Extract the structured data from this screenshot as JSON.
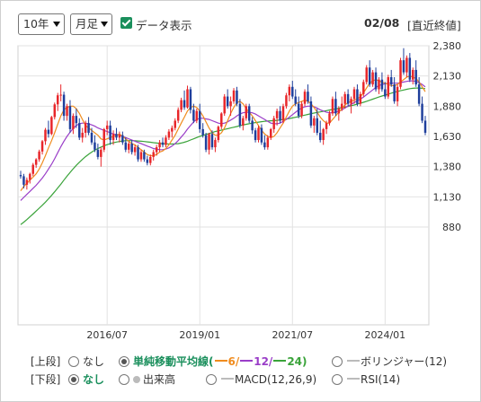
{
  "toolbar": {
    "period_select": "10年",
    "interval_select": "月足",
    "show_data_label": "データ表示",
    "date": "02/08",
    "price_type": "[直近終値]"
  },
  "panels": {
    "upper_label": "[上段]",
    "lower_label": "[下段]",
    "upper_options": {
      "none": "なし",
      "sma_prefix": "単純移動平均線(",
      "sma_6": "6/",
      "sma_12": "12/",
      "sma_24": "24)",
      "bollinger": "ボリンジャー(12)"
    },
    "lower_options": {
      "none": "なし",
      "volume": "出来高",
      "macd": "MACD(12,26,9)",
      "rsi": "RSI(14)"
    },
    "selected_upper": "sma",
    "selected_lower": "none"
  },
  "colors": {
    "up_candle": "#e8262a",
    "down_candle": "#1f3f9c",
    "ma6": "#f08c1e",
    "ma12": "#9a3ec8",
    "ma24": "#3aa33a",
    "accent_green": "#1a8f5c",
    "grid": "#e2e2e2"
  },
  "chart_data": {
    "type": "candlestick",
    "interval": "monthly",
    "period": "10年",
    "x_tick_labels": [
      "2016/07",
      "2019/01",
      "2021/07",
      "2024/01"
    ],
    "x_ticks": [
      "2016-07",
      "2019-01",
      "2021-07",
      "2024-01"
    ],
    "y_tick_labels": [
      "2,380",
      "2,130",
      "1,880",
      "1,630",
      "1,380",
      "1,130",
      "880"
    ],
    "ylim": [
      880,
      2380
    ],
    "grid": true,
    "start_month": "2014-03",
    "series_names": [
      "6",
      "12",
      "24"
    ],
    "candles_ohlc": [
      [
        1310,
        1345,
        1280,
        1300
      ],
      [
        1300,
        1320,
        1200,
        1230
      ],
      [
        1230,
        1290,
        1190,
        1270
      ],
      [
        1270,
        1330,
        1240,
        1320
      ],
      [
        1320,
        1410,
        1300,
        1395
      ],
      [
        1395,
        1450,
        1370,
        1440
      ],
      [
        1440,
        1520,
        1420,
        1505
      ],
      [
        1505,
        1600,
        1480,
        1590
      ],
      [
        1590,
        1700,
        1560,
        1685
      ],
      [
        1685,
        1760,
        1620,
        1650
      ],
      [
        1650,
        1800,
        1640,
        1790
      ],
      [
        1790,
        1910,
        1770,
        1895
      ],
      [
        1895,
        1990,
        1840,
        1970
      ],
      [
        1970,
        2060,
        1920,
        1975
      ],
      [
        1975,
        2000,
        1760,
        1800
      ],
      [
        1800,
        1900,
        1760,
        1880
      ],
      [
        1880,
        1930,
        1660,
        1690
      ],
      [
        1690,
        1820,
        1650,
        1800
      ],
      [
        1800,
        1860,
        1700,
        1740
      ],
      [
        1740,
        1780,
        1600,
        1620
      ],
      [
        1620,
        1700,
        1580,
        1660
      ],
      [
        1660,
        1760,
        1620,
        1740
      ],
      [
        1740,
        1790,
        1640,
        1660
      ],
      [
        1660,
        1700,
        1560,
        1580
      ],
      [
        1580,
        1640,
        1500,
        1520
      ],
      [
        1520,
        1570,
        1440,
        1460
      ],
      [
        1460,
        1540,
        1380,
        1520
      ],
      [
        1520,
        1700,
        1500,
        1690
      ],
      [
        1690,
        1760,
        1640,
        1720
      ],
      [
        1720,
        1760,
        1560,
        1600
      ],
      [
        1600,
        1680,
        1560,
        1650
      ],
      [
        1650,
        1700,
        1600,
        1620
      ],
      [
        1620,
        1670,
        1580,
        1640
      ],
      [
        1640,
        1670,
        1560,
        1580
      ],
      [
        1580,
        1620,
        1500,
        1520
      ],
      [
        1520,
        1590,
        1490,
        1570
      ],
      [
        1570,
        1600,
        1480,
        1500
      ],
      [
        1500,
        1560,
        1470,
        1540
      ],
      [
        1540,
        1560,
        1420,
        1440
      ],
      [
        1440,
        1520,
        1420,
        1500
      ],
      [
        1500,
        1520,
        1420,
        1440
      ],
      [
        1440,
        1470,
        1390,
        1410
      ],
      [
        1410,
        1480,
        1390,
        1460
      ],
      [
        1460,
        1520,
        1430,
        1500
      ],
      [
        1500,
        1560,
        1470,
        1540
      ],
      [
        1540,
        1600,
        1500,
        1580
      ],
      [
        1580,
        1620,
        1540,
        1560
      ],
      [
        1560,
        1640,
        1540,
        1620
      ],
      [
        1620,
        1690,
        1600,
        1670
      ],
      [
        1670,
        1720,
        1620,
        1700
      ],
      [
        1700,
        1780,
        1680,
        1760
      ],
      [
        1760,
        1870,
        1740,
        1850
      ],
      [
        1850,
        1950,
        1830,
        1930
      ],
      [
        1930,
        2010,
        1850,
        1870
      ],
      [
        1870,
        2050,
        1860,
        2020
      ],
      [
        2020,
        2040,
        1820,
        1850
      ],
      [
        1850,
        1900,
        1740,
        1760
      ],
      [
        1760,
        1860,
        1740,
        1840
      ],
      [
        1840,
        1900,
        1660,
        1690
      ],
      [
        1690,
        1740,
        1620,
        1640
      ],
      [
        1640,
        1660,
        1500,
        1520
      ],
      [
        1520,
        1660,
        1480,
        1650
      ],
      [
        1650,
        1680,
        1520,
        1540
      ],
      [
        1540,
        1620,
        1500,
        1600
      ],
      [
        1600,
        1720,
        1580,
        1710
      ],
      [
        1710,
        1830,
        1690,
        1820
      ],
      [
        1820,
        1980,
        1800,
        1960
      ],
      [
        1960,
        2020,
        1860,
        1880
      ],
      [
        1880,
        1960,
        1800,
        1920
      ],
      [
        1920,
        2030,
        1900,
        2010
      ],
      [
        2010,
        2040,
        1880,
        1900
      ],
      [
        1900,
        1940,
        1700,
        1720
      ],
      [
        1720,
        1800,
        1680,
        1780
      ],
      [
        1780,
        1900,
        1760,
        1880
      ],
      [
        1880,
        1900,
        1740,
        1760
      ],
      [
        1760,
        1790,
        1650,
        1680
      ],
      [
        1680,
        1700,
        1580,
        1600
      ],
      [
        1600,
        1720,
        1580,
        1700
      ],
      [
        1700,
        1730,
        1560,
        1580
      ],
      [
        1580,
        1640,
        1520,
        1540
      ],
      [
        1540,
        1640,
        1520,
        1620
      ],
      [
        1620,
        1700,
        1600,
        1690
      ],
      [
        1690,
        1800,
        1660,
        1780
      ],
      [
        1780,
        1860,
        1720,
        1840
      ],
      [
        1840,
        1880,
        1740,
        1760
      ],
      [
        1760,
        1900,
        1740,
        1880
      ],
      [
        1880,
        1990,
        1860,
        1970
      ],
      [
        1970,
        2060,
        1920,
        2040
      ],
      [
        2040,
        2090,
        1940,
        1960
      ],
      [
        1960,
        2020,
        1880,
        1900
      ],
      [
        1900,
        1960,
        1780,
        1800
      ],
      [
        1800,
        1920,
        1780,
        1900
      ],
      [
        1900,
        2020,
        1880,
        2000
      ],
      [
        2000,
        2060,
        1900,
        1920
      ],
      [
        1920,
        1960,
        1700,
        1720
      ],
      [
        1720,
        1800,
        1660,
        1780
      ],
      [
        1780,
        1860,
        1640,
        1660
      ],
      [
        1660,
        1760,
        1580,
        1600
      ],
      [
        1600,
        1700,
        1560,
        1690
      ],
      [
        1690,
        1760,
        1650,
        1740
      ],
      [
        1740,
        1840,
        1720,
        1820
      ],
      [
        1820,
        1960,
        1800,
        1940
      ],
      [
        1940,
        2000,
        1800,
        1820
      ],
      [
        1820,
        1880,
        1760,
        1860
      ],
      [
        1860,
        1960,
        1840,
        1900
      ],
      [
        1900,
        2000,
        1860,
        1980
      ],
      [
        1980,
        2020,
        1880,
        1900
      ],
      [
        1900,
        1960,
        1820,
        1940
      ],
      [
        1940,
        2040,
        1900,
        2020
      ],
      [
        2020,
        2060,
        1880,
        1900
      ],
      [
        1900,
        2000,
        1880,
        1980
      ],
      [
        1980,
        2100,
        1960,
        2080
      ],
      [
        2080,
        2220,
        2060,
        2200
      ],
      [
        2200,
        2260,
        2040,
        2060
      ],
      [
        2060,
        2180,
        2040,
        2160
      ],
      [
        2160,
        2200,
        2000,
        2020
      ],
      [
        2020,
        2120,
        1980,
        2100
      ],
      [
        2100,
        2160,
        2000,
        2020
      ],
      [
        2020,
        2080,
        1940,
        1960
      ],
      [
        1960,
        2140,
        1940,
        2120
      ],
      [
        2120,
        2180,
        2040,
        2060
      ],
      [
        2060,
        2120,
        1900,
        1920
      ],
      [
        1920,
        2060,
        1880,
        2040
      ],
      [
        2040,
        2280,
        2020,
        2260
      ],
      [
        2260,
        2360,
        2140,
        2160
      ],
      [
        2160,
        2300,
        2120,
        2280
      ],
      [
        2280,
        2320,
        2080,
        2100
      ],
      [
        2100,
        2200,
        2060,
        2180
      ],
      [
        2180,
        2260,
        2040,
        2060
      ],
      [
        2060,
        2120,
        1880,
        1900
      ],
      [
        1900,
        1960,
        1740,
        1760
      ],
      [
        1760,
        1800,
        1640,
        1660
      ]
    ],
    "ma6_values": [
      1180,
      1215,
      1242,
      1268,
      1292,
      1320,
      1360,
      1410,
      1470,
      1535,
      1595,
      1660,
      1730,
      1800,
      1850,
      1870,
      1880,
      1880,
      1860,
      1820,
      1770,
      1720,
      1700,
      1680,
      1660,
      1640,
      1610,
      1600,
      1610,
      1620,
      1630,
      1640,
      1650,
      1630,
      1610,
      1590,
      1570,
      1560,
      1540,
      1520,
      1500,
      1480,
      1470,
      1470,
      1480,
      1500,
      1510,
      1530,
      1560,
      1600,
      1640,
      1690,
      1740,
      1790,
      1840,
      1870,
      1880,
      1870,
      1840,
      1800,
      1750,
      1700,
      1660,
      1640,
      1640,
      1660,
      1700,
      1760,
      1820,
      1870,
      1910,
      1920,
      1900,
      1860,
      1830,
      1800,
      1760,
      1720,
      1680,
      1650,
      1630,
      1620,
      1630,
      1660,
      1700,
      1740,
      1790,
      1840,
      1880,
      1900,
      1910,
      1920,
      1930,
      1920,
      1900,
      1870,
      1830,
      1790,
      1760,
      1740,
      1740,
      1770,
      1800,
      1830,
      1860,
      1890,
      1910,
      1920,
      1930,
      1940,
      1960,
      1990,
      2030,
      2070,
      2090,
      2100,
      2090,
      2080,
      2070,
      2060,
      2050,
      2050,
      2060,
      2080,
      2100,
      2120,
      2130,
      2120,
      2110,
      2080,
      2040,
      2000
    ],
    "ma12_values": [
      1100,
      1125,
      1150,
      1175,
      1200,
      1225,
      1255,
      1285,
      1320,
      1360,
      1400,
      1445,
      1495,
      1545,
      1590,
      1630,
      1665,
      1695,
      1720,
      1735,
      1740,
      1740,
      1735,
      1725,
      1715,
      1700,
      1690,
      1680,
      1670,
      1660,
      1650,
      1645,
      1640,
      1630,
      1620,
      1610,
      1600,
      1590,
      1580,
      1570,
      1560,
      1550,
      1540,
      1530,
      1525,
      1520,
      1520,
      1525,
      1535,
      1550,
      1570,
      1595,
      1625,
      1655,
      1690,
      1720,
      1750,
      1770,
      1780,
      1780,
      1775,
      1770,
      1760,
      1750,
      1740,
      1735,
      1740,
      1750,
      1765,
      1780,
      1800,
      1815,
      1825,
      1830,
      1830,
      1825,
      1815,
      1800,
      1785,
      1770,
      1755,
      1740,
      1735,
      1735,
      1740,
      1755,
      1770,
      1790,
      1810,
      1830,
      1850,
      1865,
      1875,
      1880,
      1880,
      1875,
      1865,
      1850,
      1840,
      1830,
      1825,
      1825,
      1830,
      1840,
      1850,
      1865,
      1880,
      1895,
      1910,
      1925,
      1940,
      1955,
      1975,
      1995,
      2015,
      2035,
      2050,
      2060,
      2065,
      2070,
      2070,
      2070,
      2070,
      2075,
      2080,
      2085,
      2090,
      2090,
      2085,
      2075,
      2060,
      2040
    ],
    "ma24_values": [
      900,
      920,
      942,
      965,
      988,
      1012,
      1036,
      1060,
      1086,
      1113,
      1142,
      1172,
      1203,
      1235,
      1268,
      1300,
      1332,
      1362,
      1390,
      1416,
      1440,
      1462,
      1482,
      1500,
      1516,
      1530,
      1542,
      1553,
      1562,
      1570,
      1577,
      1583,
      1588,
      1592,
      1594,
      1595,
      1595,
      1594,
      1592,
      1590,
      1588,
      1585,
      1582,
      1578,
      1575,
      1572,
      1570,
      1568,
      1567,
      1567,
      1568,
      1570,
      1575,
      1582,
      1590,
      1600,
      1610,
      1620,
      1630,
      1638,
      1646,
      1654,
      1662,
      1670,
      1676,
      1682,
      1688,
      1694,
      1700,
      1706,
      1712,
      1718,
      1724,
      1730,
      1735,
      1740,
      1744,
      1748,
      1752,
      1755,
      1757,
      1759,
      1761,
      1763,
      1766,
      1770,
      1774,
      1778,
      1783,
      1788,
      1794,
      1800,
      1806,
      1812,
      1818,
      1823,
      1828,
      1833,
      1838,
      1843,
      1848,
      1853,
      1858,
      1863,
      1868,
      1873,
      1878,
      1884,
      1890,
      1897,
      1904,
      1912,
      1920,
      1929,
      1938,
      1947,
      1956,
      1964,
      1972,
      1980,
      1988,
      1995,
      2002,
      2008,
      2014,
      2020,
      2025,
      2028,
      2030,
      2030,
      2028,
      2025
    ]
  }
}
